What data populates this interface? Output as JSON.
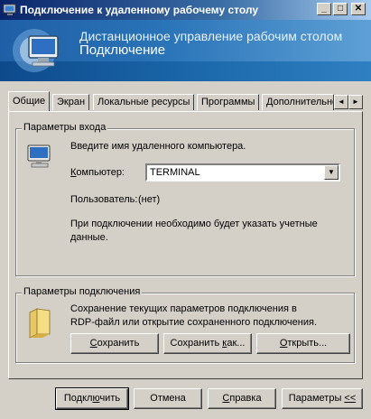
{
  "window": {
    "title": "Подключение к удаленному рабочему столу",
    "minimize_glyph": "_",
    "maximize_glyph": "□",
    "close_glyph": "✕"
  },
  "banner": {
    "line1": "Дистанционное управление рабочим столом",
    "line2": "Подключение"
  },
  "tabs": [
    {
      "label": "Общие",
      "active": true
    },
    {
      "label": "Экран",
      "active": false
    },
    {
      "label": "Локальные ресурсы",
      "active": false
    },
    {
      "label": "Программы",
      "active": false
    },
    {
      "label": "Дополнительно",
      "active": false
    }
  ],
  "tab_scroll": {
    "left": "◄",
    "right": "►"
  },
  "login": {
    "group_title": "Параметры входа",
    "prompt": "Введите имя удаленного компьютера.",
    "computer_label_accel": "К",
    "computer_label_rest": "омпьютер:",
    "computer_value": "TERMINAL",
    "user_label": "Пользователь:",
    "user_value": "(нет)",
    "note": "При подключении необходимо будет указать учетные",
    "note_line2": "данные."
  },
  "connection": {
    "group_title": "Параметры подключения",
    "description_line1": "Сохранение текущих параметров подключения в",
    "description_line2": "RDP-файл или открытие сохраненного подключения.",
    "save_accel": "С",
    "save_rest": "охранить",
    "save_as_before": "Сохранить ",
    "save_as_accel": "к",
    "save_as_after": "ак...",
    "open_accel": "О",
    "open_rest": "ткрыть..."
  },
  "footer": {
    "connect_before": "Подкл",
    "connect_accel": "ю",
    "connect_after": "чить",
    "cancel": "Отмена",
    "help_accel": "С",
    "help_rest": "правка",
    "options_before": "Параметры ",
    "options_accel": "<<",
    "options_after": ""
  },
  "colors": {
    "window_bg": "#d4d0c8",
    "titlebar_start": "#0a246a",
    "banner_blue": "#2a74b8"
  },
  "icons": {
    "app": "remote-desktop-icon",
    "banner": "computer-monitor-icon",
    "login": "monitor-icon",
    "connection": "folder-icon",
    "dropdown": "chevron-down-icon"
  }
}
